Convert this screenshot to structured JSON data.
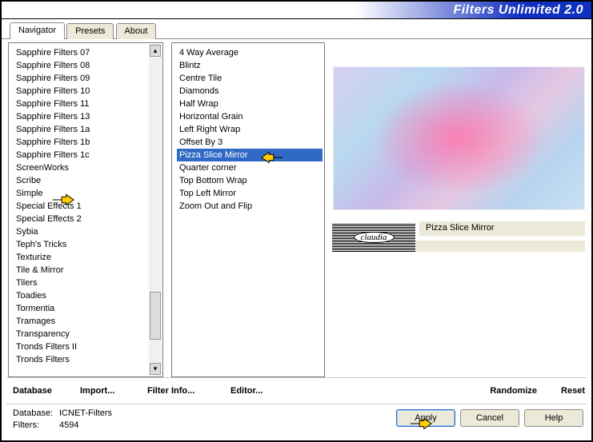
{
  "window": {
    "title": "Filters Unlimited 2.0"
  },
  "tabs": {
    "items": [
      {
        "label": "Navigator",
        "active": true
      },
      {
        "label": "Presets",
        "active": false
      },
      {
        "label": "About",
        "active": false
      }
    ]
  },
  "categories": {
    "selected_value": "Simple",
    "items": [
      "Sapphire Filters 07",
      "Sapphire Filters 08",
      "Sapphire Filters 09",
      "Sapphire Filters 10",
      "Sapphire Filters 11",
      "Sapphire Filters 13",
      "Sapphire Filters 1a",
      "Sapphire Filters 1b",
      "Sapphire Filters 1c",
      "ScreenWorks",
      "Scribe",
      "Simple",
      "Special Effects 1",
      "Special Effects 2",
      "Sybia",
      "Teph's Tricks",
      "Texturize",
      "Tile & Mirror",
      "Tilers",
      "Toadies",
      "Tormentia",
      "Tramages",
      "Transparency",
      "Tronds Filters II",
      "Tronds Filters"
    ]
  },
  "filters": {
    "selected_value": "Pizza Slice Mirror",
    "items": [
      "4 Way Average",
      "Blintz",
      "Centre Tile",
      "Diamonds",
      "Half Wrap",
      "Horizontal Grain",
      "Left Right Wrap",
      "Offset By 3",
      "Pizza Slice Mirror",
      "Quarter corner",
      "Top Bottom Wrap",
      "Top Left Mirror",
      "Zoom Out and Flip"
    ]
  },
  "right_panel": {
    "filter_name": "Pizza Slice Mirror"
  },
  "toolbar": {
    "database": "Database",
    "import": "Import...",
    "filter_info": "Filter Info...",
    "editor": "Editor...",
    "randomize": "Randomize",
    "reset": "Reset"
  },
  "status": {
    "database_label": "Database:",
    "database_value": "ICNET-Filters",
    "filters_label": "Filters:",
    "filters_value": "4594"
  },
  "buttons": {
    "apply": "Apply",
    "cancel": "Cancel",
    "help": "Help"
  },
  "watermark": {
    "label": "claudia"
  }
}
